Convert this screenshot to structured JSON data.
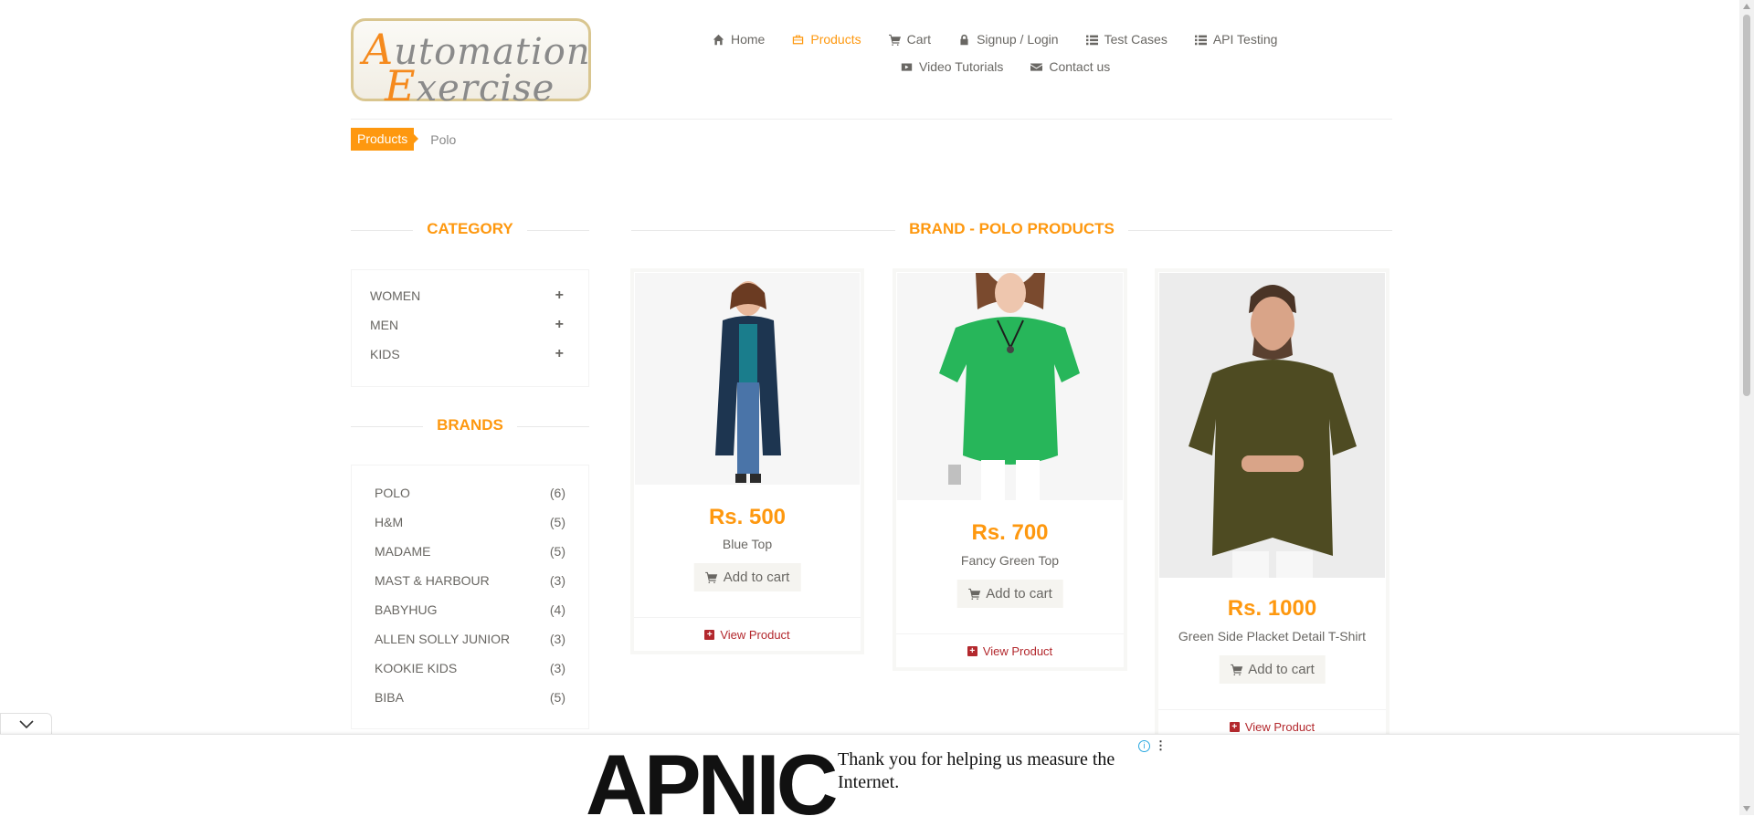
{
  "logo": {
    "line1_cap": "A",
    "line1_rest": "utomation",
    "line2_cap": "E",
    "line2_rest": "xercise"
  },
  "nav": {
    "items": [
      {
        "label": "Home",
        "icon": "home-icon"
      },
      {
        "label": "Products",
        "icon": "products-icon",
        "active": true
      },
      {
        "label": "Cart",
        "icon": "cart-icon"
      },
      {
        "label": "Signup / Login",
        "icon": "lock-icon"
      },
      {
        "label": "Test Cases",
        "icon": "list-icon"
      },
      {
        "label": "API Testing",
        "icon": "list-icon"
      },
      {
        "label": "Video Tutorials",
        "icon": "youtube-icon"
      },
      {
        "label": "Contact us",
        "icon": "envelope-icon"
      }
    ]
  },
  "breadcrumb": {
    "parent": "Products",
    "current": "Polo"
  },
  "sidebar": {
    "category_title": "CATEGORY",
    "categories": [
      {
        "label": "WOMEN",
        "toggle": "+"
      },
      {
        "label": "MEN",
        "toggle": "+"
      },
      {
        "label": "KIDS",
        "toggle": "+"
      }
    ],
    "brands_title": "BRANDS",
    "brands": [
      {
        "label": "POLO",
        "count": "(6)"
      },
      {
        "label": "H&M",
        "count": "(5)"
      },
      {
        "label": "MADAME",
        "count": "(5)"
      },
      {
        "label": "MAST & HARBOUR",
        "count": "(3)"
      },
      {
        "label": "BABYHUG",
        "count": "(4)"
      },
      {
        "label": "ALLEN SOLLY JUNIOR",
        "count": "(3)"
      },
      {
        "label": "KOOKIE KIDS",
        "count": "(3)"
      },
      {
        "label": "BIBA",
        "count": "(5)"
      }
    ]
  },
  "main": {
    "title": "BRAND - POLO PRODUCTS",
    "products": [
      {
        "price": "Rs. 500",
        "name": "Blue Top",
        "cart_label": "Add to cart",
        "view_label": "View Product"
      },
      {
        "price": "Rs. 700",
        "name": "Fancy Green Top",
        "cart_label": "Add to cart",
        "view_label": "View Product"
      },
      {
        "price": "Rs. 1000",
        "name": "Green Side Placket Detail T-Shirt",
        "cart_label": "Add to cart",
        "view_label": "View Product"
      }
    ]
  },
  "ad": {
    "brand": "APNIC",
    "message": "Thank you for helping us measure the Internet.",
    "info": "i",
    "menu": "⋮"
  },
  "colors": {
    "accent": "#FE980F",
    "view_product": "#B3282D",
    "text": "#696763"
  }
}
